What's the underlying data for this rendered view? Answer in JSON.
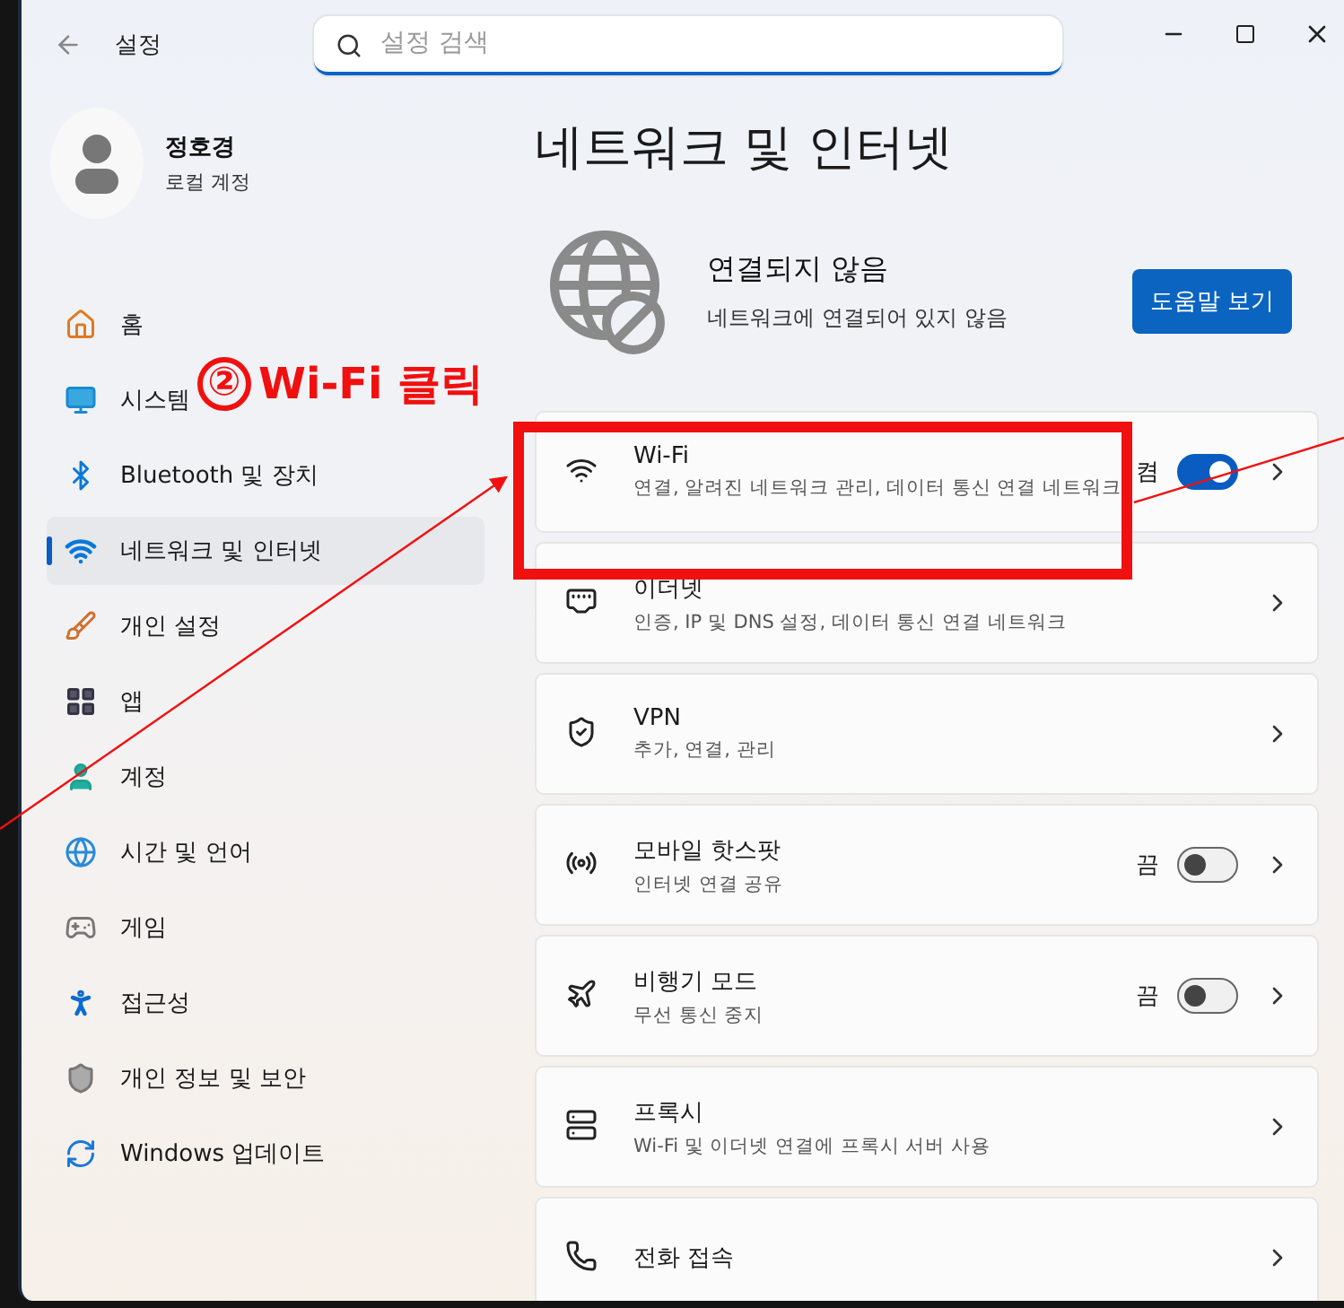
{
  "window": {
    "title": "설정"
  },
  "search": {
    "placeholder": "설정 검색"
  },
  "account": {
    "name": "정호경",
    "type": "로컬 계정"
  },
  "nav": [
    {
      "label": "홈",
      "selected": false
    },
    {
      "label": "시스템",
      "selected": false
    },
    {
      "label": "Bluetooth 및 장치",
      "selected": false
    },
    {
      "label": "네트워크 및 인터넷",
      "selected": true
    },
    {
      "label": "개인 설정",
      "selected": false
    },
    {
      "label": "앱",
      "selected": false
    },
    {
      "label": "계정",
      "selected": false
    },
    {
      "label": "시간 및 언어",
      "selected": false
    },
    {
      "label": "게임",
      "selected": false
    },
    {
      "label": "접근성",
      "selected": false
    },
    {
      "label": "개인 정보 및 보안",
      "selected": false
    },
    {
      "label": "Windows 업데이트",
      "selected": false
    }
  ],
  "page_title": "네트워크 및 인터넷",
  "status": {
    "title": "연결되지 않음",
    "subtitle": "네트워크에 연결되어 있지 않음",
    "button": "도움말 보기"
  },
  "settings": [
    {
      "kind": "toggle",
      "title": "Wi-Fi",
      "subtitle": "연결, 알려진 네트워크 관리, 데이터 통신 연결 네트워크",
      "state_label": "켬",
      "on": true
    },
    {
      "kind": "link",
      "title": "이더넷",
      "subtitle": "인증, IP 및 DNS 설정, 데이터 통신 연결 네트워크"
    },
    {
      "kind": "link",
      "title": "VPN",
      "subtitle": "추가, 연결, 관리"
    },
    {
      "kind": "toggle",
      "title": "모바일 핫스팟",
      "subtitle": "인터넷 연결 공유",
      "state_label": "끔",
      "on": false
    },
    {
      "kind": "toggle",
      "title": "비행기 모드",
      "subtitle": "무선 통신 중지",
      "state_label": "끔",
      "on": false
    },
    {
      "kind": "link",
      "title": "프록시",
      "subtitle": "Wi-Fi 및 이더넷 연결에 프록시 서버 사용"
    },
    {
      "kind": "link",
      "title": "전화 접속"
    }
  ],
  "annotation": {
    "number": "②",
    "text": "Wi-Fi 클릭"
  }
}
